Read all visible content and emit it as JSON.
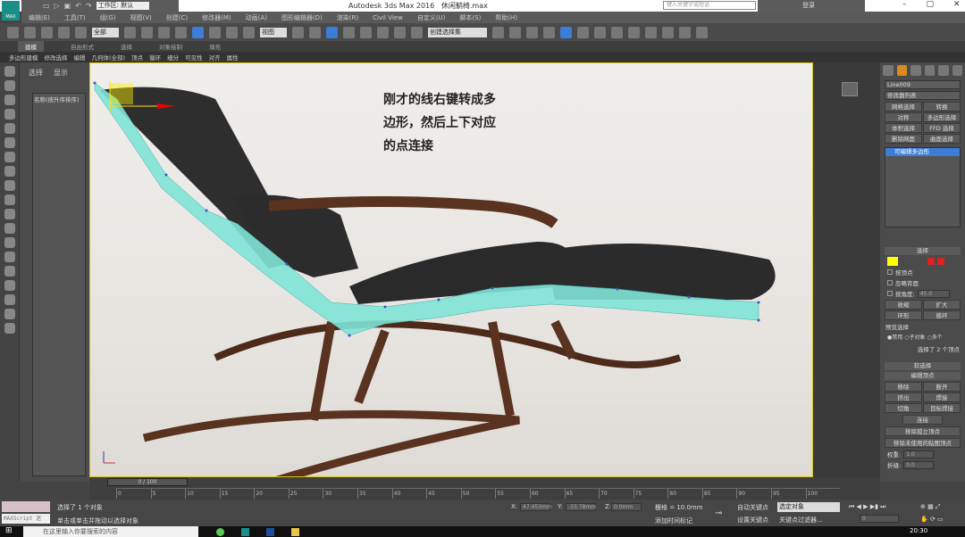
{
  "title_bar": {
    "workspace": "工作区: 默认",
    "app_title": "Autodesk 3ds Max 2016",
    "file_name": "休闲躺椅.max",
    "search_placeholder": "键入关键字或短语",
    "sign_in": "登录",
    "logo_text": "MAX"
  },
  "menu": [
    "编辑(E)",
    "工具(T)",
    "组(G)",
    "视图(V)",
    "创建(C)",
    "修改器(M)",
    "动画(A)",
    "图形编辑器(D)",
    "渲染(R)",
    "Civil View",
    "自定义(U)",
    "脚本(S)",
    "帮助(H)"
  ],
  "toolbar": {
    "selection_filter": "全部",
    "ref_coord": "视图",
    "named_selection": "创建选择集"
  },
  "ribbon": {
    "tabs": [
      "建模",
      "自由形式",
      "选择",
      "对象绘制",
      "填充"
    ],
    "active_tab": "建模",
    "row": [
      "多边形建模",
      "修改选择",
      "编辑",
      "几何体(全部)",
      "顶点",
      "循环",
      "细分",
      "可见性",
      "对齐",
      "属性"
    ]
  },
  "scene_explorer": {
    "tabs": [
      "选择",
      "显示"
    ],
    "column": "名称(按升序排序)"
  },
  "viewport": {
    "annotation": "刚才的线右键转成多\n边形，然后上下对应\n的点连接",
    "accent": "#7fe3d6"
  },
  "modify_panel": {
    "object_name": "Line009",
    "modifier_list": "修改器列表",
    "buttons": [
      "网格选择",
      "转换",
      "对称",
      "多边形选择",
      "体积选择",
      "FFD 选择",
      "删除网面",
      "曲面选择"
    ],
    "stack_item": "可编辑多边形",
    "selection_title": "选择",
    "by_vertex": "按顶点",
    "ignore_backfacing": "忽略背面",
    "by_angle": "按角度:",
    "angle_value": "45.0",
    "shrink": "收缩",
    "grow": "扩大",
    "ring": "环形",
    "loop": "循环",
    "preview_title": "预览选择",
    "preview_options": [
      "禁用",
      "子对象",
      "多个"
    ],
    "selection_info": "选择了 2 个顶点",
    "soft_selection": "软选择",
    "edit_vertices": "编辑顶点",
    "remove": "移除",
    "break": "断开",
    "extrude": "挤出",
    "weld": "焊接",
    "chamfer": "切角",
    "target_weld": "目标焊接",
    "connect": "连接",
    "remove_isolated": "移除孤立顶点",
    "remove_unused": "移除未使用的贴图顶点",
    "weight_label": "权重:",
    "weight_value": "1.0",
    "crease_label": "折缝:",
    "crease_value": "0.0"
  },
  "timeline": {
    "frame": "0 / 100",
    "ticks": [
      "0",
      "5",
      "10",
      "15",
      "20",
      "25",
      "30",
      "35",
      "40",
      "45",
      "50",
      "55",
      "60",
      "65",
      "70",
      "75",
      "80",
      "85",
      "90",
      "95",
      "100"
    ]
  },
  "status": {
    "maxscript": "MAXScript 迷",
    "selected": "选择了 1 个对象",
    "prompt": "单击或单击并拖动以选择对象",
    "x": "47.453mm",
    "y": "-33.78mm",
    "z": "0.0mm",
    "grid": "栅格 = 10.0mm",
    "add_time_tag": "添加时间标记",
    "auto_key": "自动关键点",
    "set_key": "设置关键点",
    "key_mode": "选定对象",
    "key_filters": "关键点过滤器...",
    "current_frame": "0"
  },
  "taskbar": {
    "search": "在这里输入你要搜索的内容",
    "time": "20:30"
  }
}
